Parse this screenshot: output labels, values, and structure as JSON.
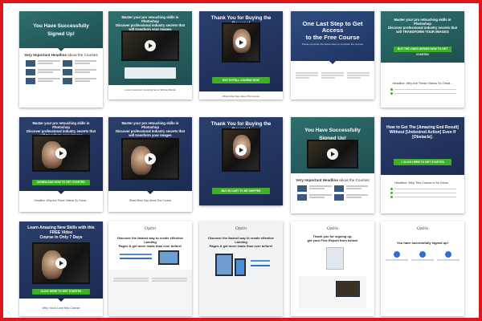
{
  "gallery": {
    "templates": [
      {
        "title": "You Have Successfully Signed Up!",
        "body_head_a": "Very Important Headline",
        "body_head_b": "about the Courses"
      },
      {
        "title": "Master your pro retouching skills in Photoshop\nDiscover professional industry secrets that\nwill transform your images",
        "caption": "Lorem Instructor: Amazing Set of Writing Blocks"
      },
      {
        "title": "Thank You for Buying the Course!",
        "button": "BUY IN FULL COURSE NOW",
        "caption": "What Other Say About The Course"
      },
      {
        "title": "One Last Step to Get Access\nto the Free Course",
        "sub": "Please complete the below steps to complete the process"
      },
      {
        "title": "Master your pro retouching skills in Photoshop\nDiscover professional industry secrets that\nwill TRANSFORM YOUR IMAGES",
        "button": "BUY THE VIDEO SERIES NOW TO GET STARTED",
        "caption": "Headline: Why Are These Videos So Great..."
      },
      {
        "title": "Master your pro retouching skills in Photoshop\nDiscover professional industry secrets that\nwill transform your images",
        "button": "DOWNLOAD NOW TO GET STARTED",
        "caption": "Headline: Why Are These Videos So Great..."
      },
      {
        "title": "Master your pro retouching skills in Photoshop\nDiscover professional industry secrets that\nwill transform your images",
        "caption": "What Other Say About The Course"
      },
      {
        "title": "Thank You for Buying the Course!",
        "button": "BUY IN CART TO BE SHIPPED",
        "caption": ""
      },
      {
        "title": "You Have Successfully Signed Up!",
        "body_head_a": "Very Important Headline",
        "body_head_b": "about the Courses"
      },
      {
        "title": "How to Get The [Amazing End Result]\nWithout [Undesired Action] Even If\n[Obstacle].",
        "button": "> CLICK HERE TO GET STARTED",
        "caption": "Headline: Why This Course is So Great..."
      },
      {
        "title": "Learn Amazing New Skills with this FREE Video\nCourse in Only 7 Days",
        "button": "CLICK HERE TO GET STARTED",
        "caption": "Why You'll Love this Course"
      },
      {
        "title": "Discover the fastest way to create effective Landing\nPages & get more leads than ever before!",
        "logo": "Optin"
      },
      {
        "title": "Discover the fastest way to create effective Landing\nPages & get more leads than ever before!",
        "logo": "Optin"
      },
      {
        "title": "Thank you for signing up,\nget your Free Report from below!",
        "logo": "Optin"
      },
      {
        "title": "You have successfully signed up!",
        "logo": "Optin"
      }
    ]
  },
  "colors": {
    "frame_border": "#e0161e",
    "cta_green": "#3fae2a",
    "accent_green": "#8bd35a"
  }
}
